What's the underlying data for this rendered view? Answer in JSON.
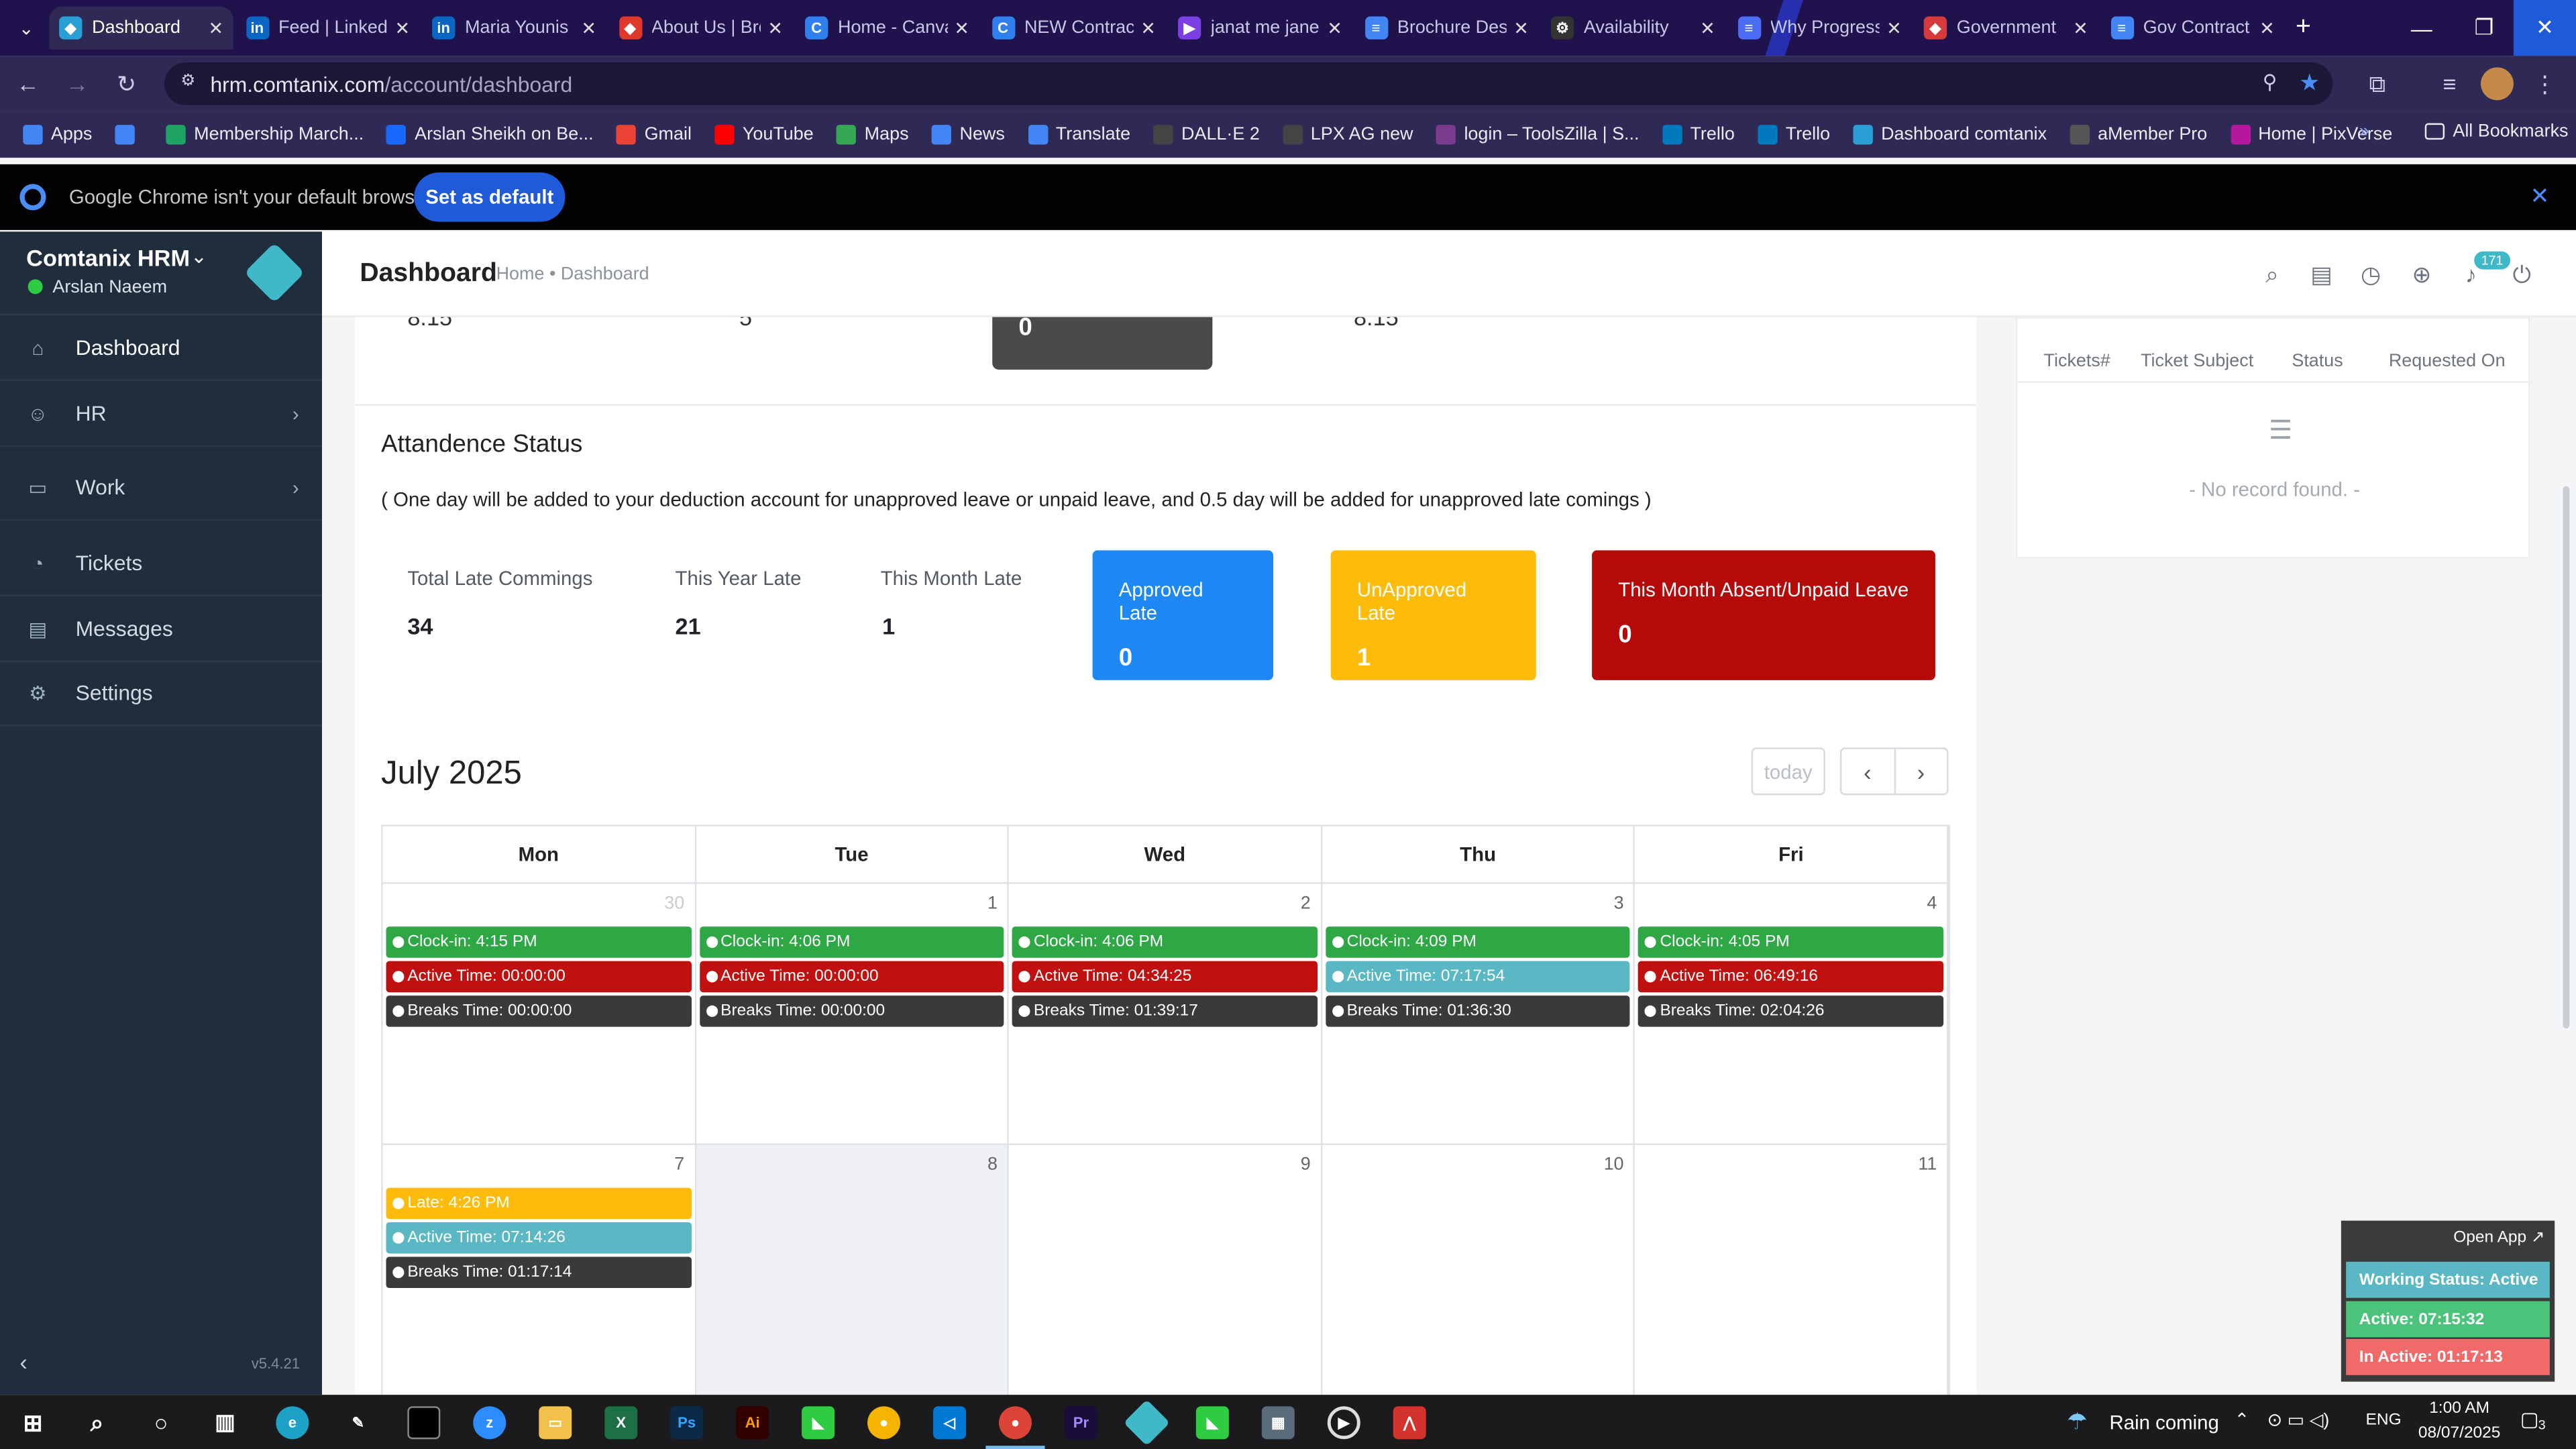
{
  "browser": {
    "tabs": [
      {
        "title": "Dashboard",
        "icon": "comtanix-icon",
        "color": "#2a9fd6",
        "glyph": "◆"
      },
      {
        "title": "Feed | LinkedIn",
        "icon": "linkedin-icon",
        "color": "#0a66c2",
        "glyph": "in"
      },
      {
        "title": "Maria Younis",
        "icon": "linkedin-icon",
        "color": "#0a66c2",
        "glyph": "in"
      },
      {
        "title": "About Us | Brochure",
        "icon": "brochure-icon",
        "color": "#e0392b",
        "glyph": "◆"
      },
      {
        "title": "Home - Canva",
        "icon": "canva-icon",
        "color": "#2f80ed",
        "glyph": "C"
      },
      {
        "title": "NEW Contract",
        "icon": "canva-icon",
        "color": "#2f80ed",
        "glyph": "C"
      },
      {
        "title": "janat me jane",
        "icon": "video-icon",
        "color": "#7b3fe4",
        "glyph": "▶"
      },
      {
        "title": "Brochure Design",
        "icon": "docs-icon",
        "color": "#4285f4",
        "glyph": "≡"
      },
      {
        "title": "Availability",
        "icon": "openai-icon",
        "color": "#333333",
        "glyph": "⚙"
      },
      {
        "title": "Why Progress",
        "icon": "forms-icon",
        "color": "#4a6cf7",
        "glyph": "≡"
      },
      {
        "title": "Government",
        "icon": "gov-icon",
        "color": "#d63a3a",
        "glyph": "◆"
      },
      {
        "title": "Gov Contract",
        "icon": "docs-icon",
        "color": "#4285f4",
        "glyph": "≡"
      }
    ],
    "url_host": "hrm.comtanix.com",
    "url_path": "/account/dashboard",
    "bookmarks": [
      {
        "label": "Apps",
        "color": "#4285f4"
      },
      {
        "label": "",
        "color": "#4285f4"
      },
      {
        "label": "Membership March...",
        "color": "#1ea362"
      },
      {
        "label": "Arslan Sheikh on Be...",
        "color": "#1769ff"
      },
      {
        "label": "Gmail",
        "color": "#ea4335"
      },
      {
        "label": "YouTube",
        "color": "#ff0000"
      },
      {
        "label": "Maps",
        "color": "#34a853"
      },
      {
        "label": "News",
        "color": "#4285f4"
      },
      {
        "label": "Translate",
        "color": "#4285f4"
      },
      {
        "label": "DALL·E 2",
        "color": "#444444"
      },
      {
        "label": "LPX AG new",
        "color": "#444444"
      },
      {
        "label": "login – ToolsZilla | S...",
        "color": "#7a3b8f"
      },
      {
        "label": "Trello",
        "color": "#0079bf"
      },
      {
        "label": "Trello",
        "color": "#0079bf"
      },
      {
        "label": "Dashboard comtanix",
        "color": "#2a9fd6"
      },
      {
        "label": "aMember Pro",
        "color": "#555555"
      },
      {
        "label": "Home | PixVerse",
        "color": "#b5179e"
      }
    ],
    "all_bookmarks": "All Bookmarks",
    "infobar_text": "Google Chrome isn't your default browser",
    "set_default": "Set as default"
  },
  "sidebar": {
    "app_name": "Comtanix HRM",
    "user_name": "Arslan Naeem",
    "items": [
      {
        "label": "Dashboard",
        "icon": "home-icon",
        "glyph": "⌂",
        "has_arrow": false
      },
      {
        "label": "HR",
        "icon": "users-icon",
        "glyph": "☺",
        "has_arrow": true
      },
      {
        "label": "Work",
        "icon": "briefcase-icon",
        "glyph": "▭",
        "has_arrow": true
      },
      {
        "label": "Tickets",
        "icon": "headset-icon",
        "glyph": "◔",
        "has_arrow": false
      },
      {
        "label": "Messages",
        "icon": "chat-icon",
        "glyph": "▤",
        "has_arrow": false
      },
      {
        "label": "Settings",
        "icon": "gear-icon",
        "glyph": "⚙",
        "has_arrow": false
      }
    ],
    "version": "v5.4.21"
  },
  "header": {
    "title": "Dashboard",
    "breadcrumb": "Home • Dashboard",
    "notification_count": "171"
  },
  "top_partial": {
    "values": [
      "8.15",
      "5",
      "0",
      "8.15"
    ]
  },
  "attendance": {
    "title": "Attandence Status",
    "note": "( One day will be added to your deduction account for unapproved leave or unpaid leave, and 0.5 day will be added for unapproved late comings )",
    "stats": [
      {
        "label": "Total Late Commings",
        "value": "34"
      },
      {
        "label": "This Year Late",
        "value": "21"
      },
      {
        "label": "This Month Late",
        "value": "1"
      }
    ],
    "cards": [
      {
        "label": "Approved Late",
        "value": "0",
        "color": "#1e88f5"
      },
      {
        "label": "UnApproved Late",
        "value": "1",
        "color": "#fdbb0c"
      },
      {
        "label": "This Month Absent/Unpaid Leave",
        "value": "0",
        "color": "#b50a0a"
      }
    ]
  },
  "calendar": {
    "month": "July 2025",
    "today_label": "today",
    "days": [
      "Mon",
      "Tue",
      "Wed",
      "Thu",
      "Fri"
    ],
    "week1": [
      {
        "day": "30",
        "events": [
          {
            "text": "Clock-in: 4:15 PM",
            "color": "#2ea845"
          },
          {
            "text": "Active Time: 00:00:00",
            "color": "#c0100f"
          },
          {
            "text": "Breaks Time: 00:00:00",
            "color": "#3a3a3a"
          }
        ]
      },
      {
        "day": "1",
        "events": [
          {
            "text": "Clock-in: 4:06 PM",
            "color": "#2ea845"
          },
          {
            "text": "Active Time: 00:00:00",
            "color": "#c0100f"
          },
          {
            "text": "Breaks Time: 00:00:00",
            "color": "#3a3a3a"
          }
        ]
      },
      {
        "day": "2",
        "events": [
          {
            "text": "Clock-in: 4:06 PM",
            "color": "#2ea845"
          },
          {
            "text": "Active Time: 04:34:25",
            "color": "#c0100f"
          },
          {
            "text": "Breaks Time: 01:39:17",
            "color": "#3a3a3a"
          }
        ]
      },
      {
        "day": "3",
        "events": [
          {
            "text": "Clock-in: 4:09 PM",
            "color": "#2ea845"
          },
          {
            "text": "Active Time: 07:17:54",
            "color": "#5ab8c4"
          },
          {
            "text": "Breaks Time: 01:36:30",
            "color": "#3a3a3a"
          }
        ]
      },
      {
        "day": "4",
        "events": [
          {
            "text": "Clock-in: 4:05 PM",
            "color": "#2ea845"
          },
          {
            "text": "Active Time: 06:49:16",
            "color": "#c0100f"
          },
          {
            "text": "Breaks Time: 02:04:26",
            "color": "#3a3a3a"
          }
        ]
      }
    ],
    "week2": [
      {
        "day": "7",
        "events": [
          {
            "text": "Late: 4:26 PM",
            "color": "#fdbb0c"
          },
          {
            "text": "Active Time: 07:14:26",
            "color": "#5ab8c4"
          },
          {
            "text": "Breaks Time: 01:17:14",
            "color": "#3a3a3a"
          }
        ]
      },
      {
        "day": "8",
        "events": []
      },
      {
        "day": "9",
        "events": []
      },
      {
        "day": "10",
        "events": []
      },
      {
        "day": "11",
        "events": []
      }
    ]
  },
  "tickets": {
    "columns": [
      "Tickets#",
      "Ticket Subject",
      "Status",
      "Requested On"
    ],
    "empty": "- No record found. -"
  },
  "widget": {
    "open_app": "Open App ↗",
    "working_status": "Working Status: Active",
    "active": "Active: 07:15:32",
    "inactive": "In Active: 01:17:13"
  },
  "taskbar": {
    "weather": "Rain coming",
    "lang": "ENG",
    "time": "1:00 AM",
    "date": "08/07/2025",
    "notif": "3"
  }
}
